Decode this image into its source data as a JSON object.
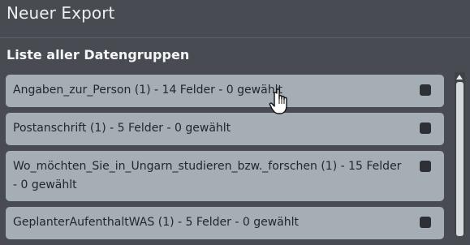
{
  "window": {
    "title": "Neuer Export"
  },
  "section": {
    "heading": "Liste aller Datengruppen"
  },
  "datagroups": [
    {
      "label": "Angaben_zur_Person (1) - 14 Felder - 0 gewählt",
      "checked": false
    },
    {
      "label": "Postanschrift (1) - 5 Felder - 0 gewählt",
      "checked": false
    },
    {
      "label": "Wo_möchten_Sie_in_Ungarn_studieren_bzw._forschen (1) - 15 Felder - 0 gewählt",
      "checked": false
    },
    {
      "label": "GeplanterAufenthaltWAS (1) - 5 Felder - 0 gewählt",
      "checked": false
    }
  ],
  "icons": {
    "cursor": "hand-pointer-icon",
    "scroll_up": "chevron-up-icon"
  }
}
